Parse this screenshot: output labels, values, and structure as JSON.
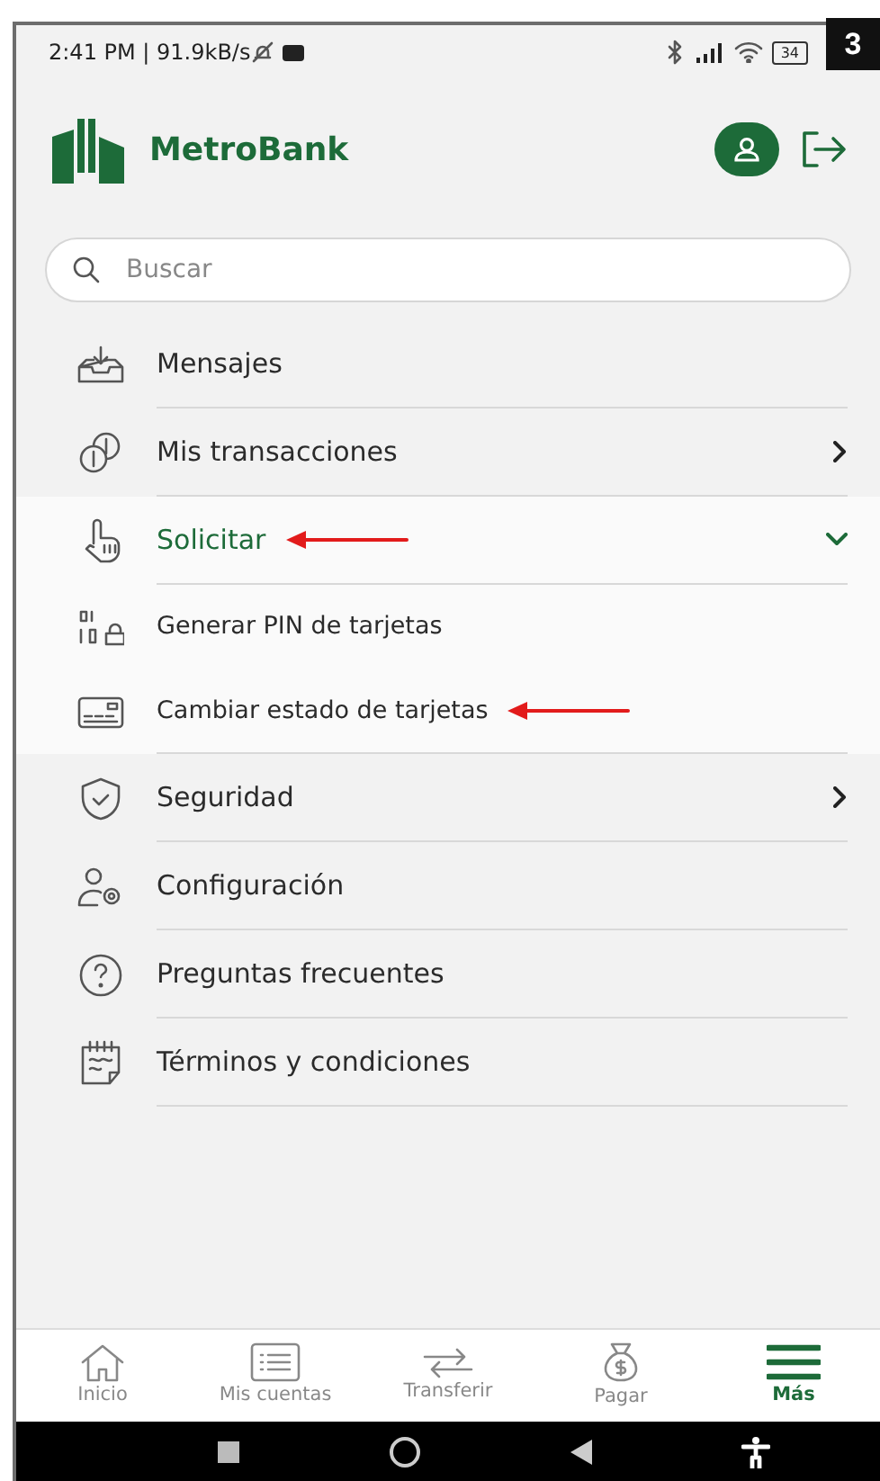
{
  "step_badge": "3",
  "status_bar": {
    "time": "2:41 PM | 91.9kB/s",
    "battery": "34"
  },
  "header": {
    "brand": "MetroBank"
  },
  "search": {
    "placeholder": "Buscar"
  },
  "menu": [
    {
      "label": "Mensajes",
      "annotated": false
    },
    {
      "label": "Mis transacciones",
      "expanded": false,
      "annotated": false
    },
    {
      "label": "Solicitar",
      "expanded": true,
      "annotated": true,
      "children": [
        {
          "label": "Generar PIN de tarjetas",
          "annotated": false
        },
        {
          "label": "Cambiar estado de tarjetas",
          "annotated": true
        }
      ]
    },
    {
      "label": "Seguridad",
      "expanded": false,
      "annotated": false
    },
    {
      "label": "Configuración",
      "annotated": false
    },
    {
      "label": "Preguntas frecuentes",
      "annotated": false
    },
    {
      "label": "Términos y condiciones",
      "annotated": false
    }
  ],
  "bottom_nav": [
    {
      "label": "Inicio",
      "selected": false
    },
    {
      "label": "Mis cuentas",
      "selected": false
    },
    {
      "label": "Transferir",
      "selected": false
    },
    {
      "label": "Pagar",
      "selected": false
    },
    {
      "label": "Más",
      "selected": true
    }
  ]
}
